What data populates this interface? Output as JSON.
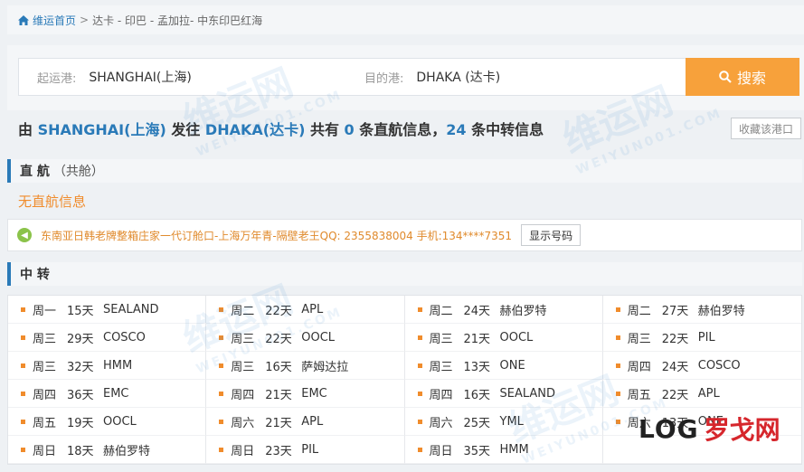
{
  "breadcrumb": {
    "home": "维运首页",
    "sep": ">",
    "path": "达卡 - 印巴 - 孟加拉- 中东印巴红海"
  },
  "search": {
    "origin_label": "起运港:",
    "origin_value": "SHANGHAI(上海)",
    "dest_label": "目的港:",
    "dest_value": "DHAKA (达卡)",
    "button": "搜索"
  },
  "summary": {
    "p1": "由 ",
    "origin": "SHANGHAI(上海)",
    "p2": " 发往 ",
    "dest": "DHAKA(达卡)",
    "p3": " 共有 ",
    "direct_count": "0",
    "p4": " 条直航信息，",
    "transfer_count": "24",
    "p5": " 条中转信息"
  },
  "fav_button": "收藏该港口",
  "direct": {
    "title": "直 航",
    "sub": "（共舱）",
    "empty": "无直航信息"
  },
  "notice": {
    "text": "东南亚日韩老牌整箱庄家一代订舱口-上海万年青-隔壁老王QQ: 2355838004 手机:134****7351",
    "button": "显示号码"
  },
  "transfer": {
    "title": "中 转",
    "rows": [
      [
        {
          "day": "周一",
          "dur": "15天",
          "carrier": "SEALAND"
        },
        {
          "day": "周二",
          "dur": "22天",
          "carrier": "APL"
        },
        {
          "day": "周二",
          "dur": "24天",
          "carrier": "赫伯罗特"
        },
        {
          "day": "周二",
          "dur": "27天",
          "carrier": "赫伯罗特"
        }
      ],
      [
        {
          "day": "周三",
          "dur": "29天",
          "carrier": "COSCO"
        },
        {
          "day": "周三",
          "dur": "22天",
          "carrier": "OOCL"
        },
        {
          "day": "周三",
          "dur": "21天",
          "carrier": "OOCL"
        },
        {
          "day": "周三",
          "dur": "22天",
          "carrier": "PIL"
        }
      ],
      [
        {
          "day": "周三",
          "dur": "32天",
          "carrier": "HMM"
        },
        {
          "day": "周三",
          "dur": "16天",
          "carrier": "萨姆达拉"
        },
        {
          "day": "周三",
          "dur": "13天",
          "carrier": "ONE"
        },
        {
          "day": "周四",
          "dur": "24天",
          "carrier": "COSCO"
        }
      ],
      [
        {
          "day": "周四",
          "dur": "36天",
          "carrier": "EMC"
        },
        {
          "day": "周四",
          "dur": "21天",
          "carrier": "EMC"
        },
        {
          "day": "周四",
          "dur": "16天",
          "carrier": "SEALAND"
        },
        {
          "day": "周五",
          "dur": "22天",
          "carrier": "APL"
        }
      ],
      [
        {
          "day": "周五",
          "dur": "19天",
          "carrier": "OOCL"
        },
        {
          "day": "周六",
          "dur": "21天",
          "carrier": "APL"
        },
        {
          "day": "周六",
          "dur": "25天",
          "carrier": "YML"
        },
        {
          "day": "周六",
          "dur": "13天",
          "carrier": "ONE"
        }
      ],
      [
        {
          "day": "周日",
          "dur": "18天",
          "carrier": "赫伯罗特"
        },
        {
          "day": "周日",
          "dur": "23天",
          "carrier": "PIL"
        },
        {
          "day": "周日",
          "dur": "35天",
          "carrier": "HMM"
        },
        {
          "day": "",
          "dur": "",
          "carrier": ""
        }
      ]
    ]
  },
  "watermark": {
    "main": "维运网",
    "sub": "WEIYUN001.COM"
  },
  "logo": {
    "part1": "LOG",
    "part2": "罗戈网"
  }
}
